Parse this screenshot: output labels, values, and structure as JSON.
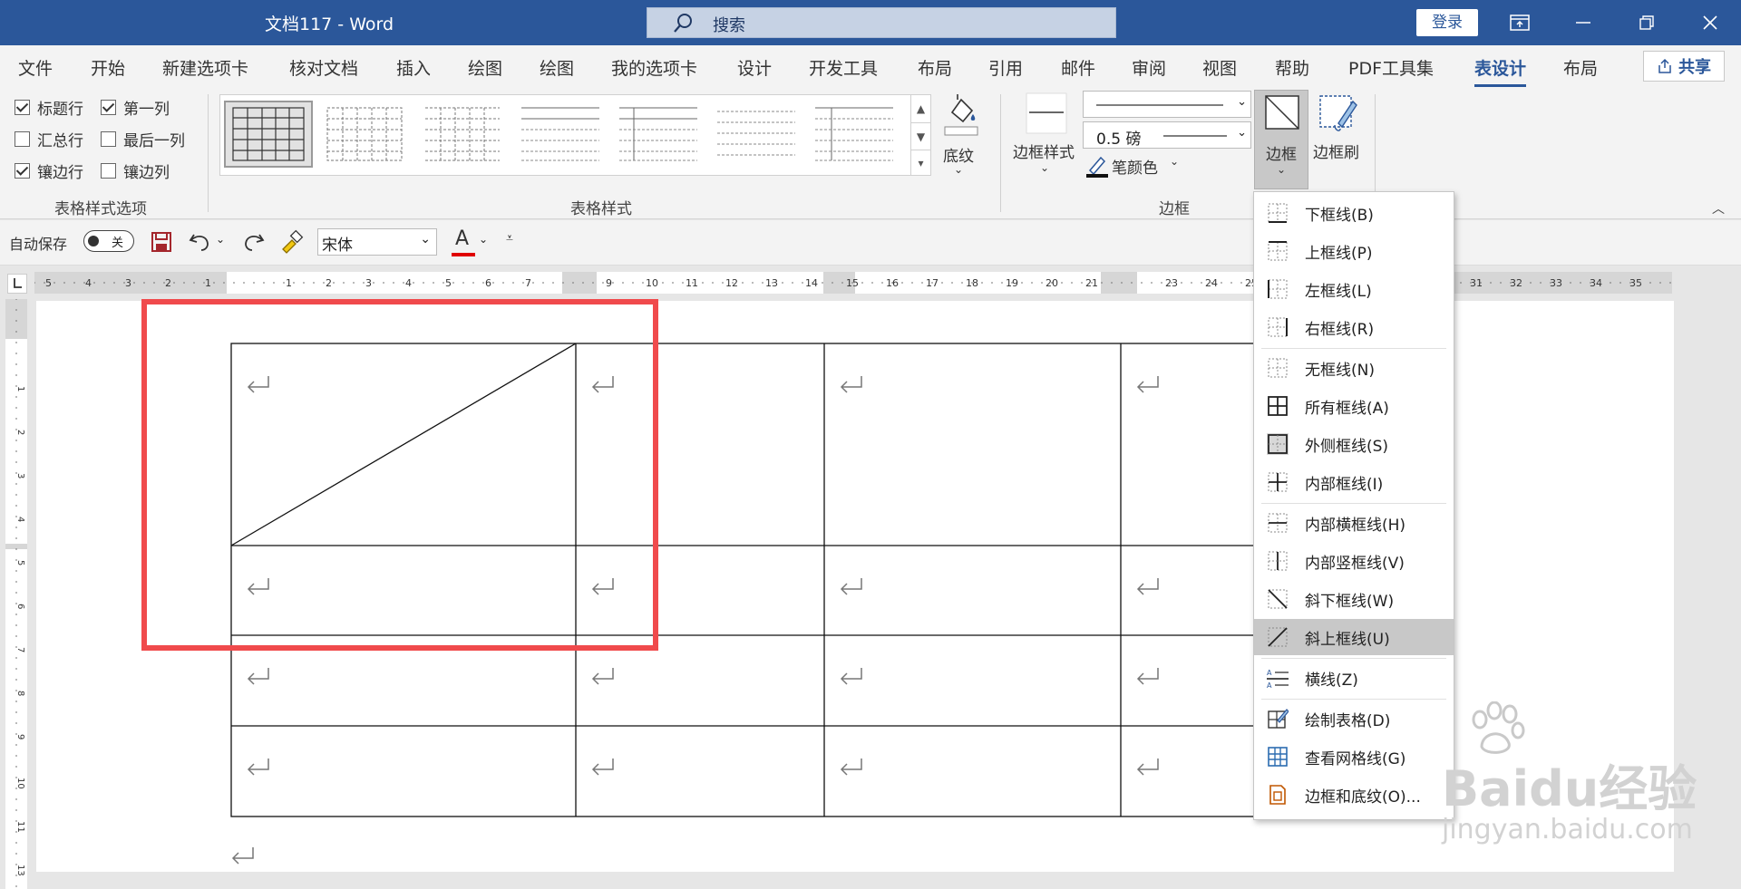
{
  "titlebar": {
    "title": "文档117  -  Word",
    "search_text": "搜索",
    "login_label": "登录",
    "colors": {
      "background": "#2b579a"
    }
  },
  "menu": {
    "tabs": [
      "文件",
      "开始",
      "新建选项卡",
      "核对文档",
      "插入",
      "绘图",
      "绘图",
      "我的选项卡",
      "设计",
      "开发工具",
      "布局",
      "引用",
      "邮件",
      "审阅",
      "视图",
      "帮助",
      "PDF工具集",
      "表设计",
      "布局"
    ],
    "active_tab": "表设计",
    "share_label": "共享"
  },
  "ribbon": {
    "style_options": {
      "group_label": "表格样式选项",
      "checkboxes": [
        {
          "label": "标题行",
          "checked": true
        },
        {
          "label": "第一列",
          "checked": true
        },
        {
          "label": "汇总行",
          "checked": false
        },
        {
          "label": "最后一列",
          "checked": false
        },
        {
          "label": "镶边行",
          "checked": true
        },
        {
          "label": "镶边列",
          "checked": false
        }
      ]
    },
    "table_styles": {
      "group_label": "表格样式"
    },
    "shading_label": "底纹",
    "borders": {
      "group_label": "边框",
      "border_styles_label": "边框样式",
      "pen_weight": "0.5 磅",
      "pen_color_label": "笔颜色",
      "borders_label": "边框",
      "border_painter_label": "边框刷"
    }
  },
  "qat": {
    "autosave_label": "自动保存",
    "toggle_state": "关",
    "font_name": "宋体",
    "font_color_letter": "A"
  },
  "hruler": {
    "labels": [
      "5",
      "4",
      "3",
      "2",
      "1",
      "1",
      "2",
      "3",
      "4",
      "5",
      "6",
      "7",
      "9",
      "10",
      "11",
      "12",
      "13",
      "14",
      "15",
      "16",
      "17",
      "18",
      "19",
      "20",
      "21",
      "23",
      "24",
      "25",
      "31",
      "32",
      "33",
      "34",
      "35"
    ]
  },
  "vruler": {
    "labels": [
      "1",
      "2",
      "3",
      "4",
      "5",
      "6",
      "7",
      "8",
      "9",
      "10",
      "11",
      "13"
    ]
  },
  "borders_menu": {
    "items": [
      {
        "label": "下框线(B)",
        "icon": "bottom-border-icon"
      },
      {
        "label": "上框线(P)",
        "icon": "top-border-icon"
      },
      {
        "label": "左框线(L)",
        "icon": "left-border-icon"
      },
      {
        "label": "右框线(R)",
        "icon": "right-border-icon"
      },
      {
        "label": "无框线(N)",
        "icon": "no-border-icon"
      },
      {
        "label": "所有框线(A)",
        "icon": "all-borders-icon"
      },
      {
        "label": "外侧框线(S)",
        "icon": "outside-borders-icon"
      },
      {
        "label": "内部框线(I)",
        "icon": "inside-borders-icon"
      },
      {
        "label": "内部横框线(H)",
        "icon": "inside-horizontal-border-icon"
      },
      {
        "label": "内部竖框线(V)",
        "icon": "inside-vertical-border-icon"
      },
      {
        "label": "斜下框线(W)",
        "icon": "diagonal-down-border-icon"
      },
      {
        "label": "斜上框线(U)",
        "icon": "diagonal-up-border-icon",
        "highlighted": true
      },
      {
        "label": "横线(Z)",
        "icon": "horizontal-line-icon"
      },
      {
        "label": "绘制表格(D)",
        "icon": "draw-table-icon"
      },
      {
        "label": "查看网格线(G)",
        "icon": "view-gridlines-icon"
      },
      {
        "label": "边框和底纹(O)...",
        "icon": "borders-and-shading-icon"
      }
    ]
  },
  "watermark": {
    "brand": "Baidu经验",
    "url": "jingyan.baidu.com"
  },
  "annotation": {
    "color": "#f04a4c"
  }
}
